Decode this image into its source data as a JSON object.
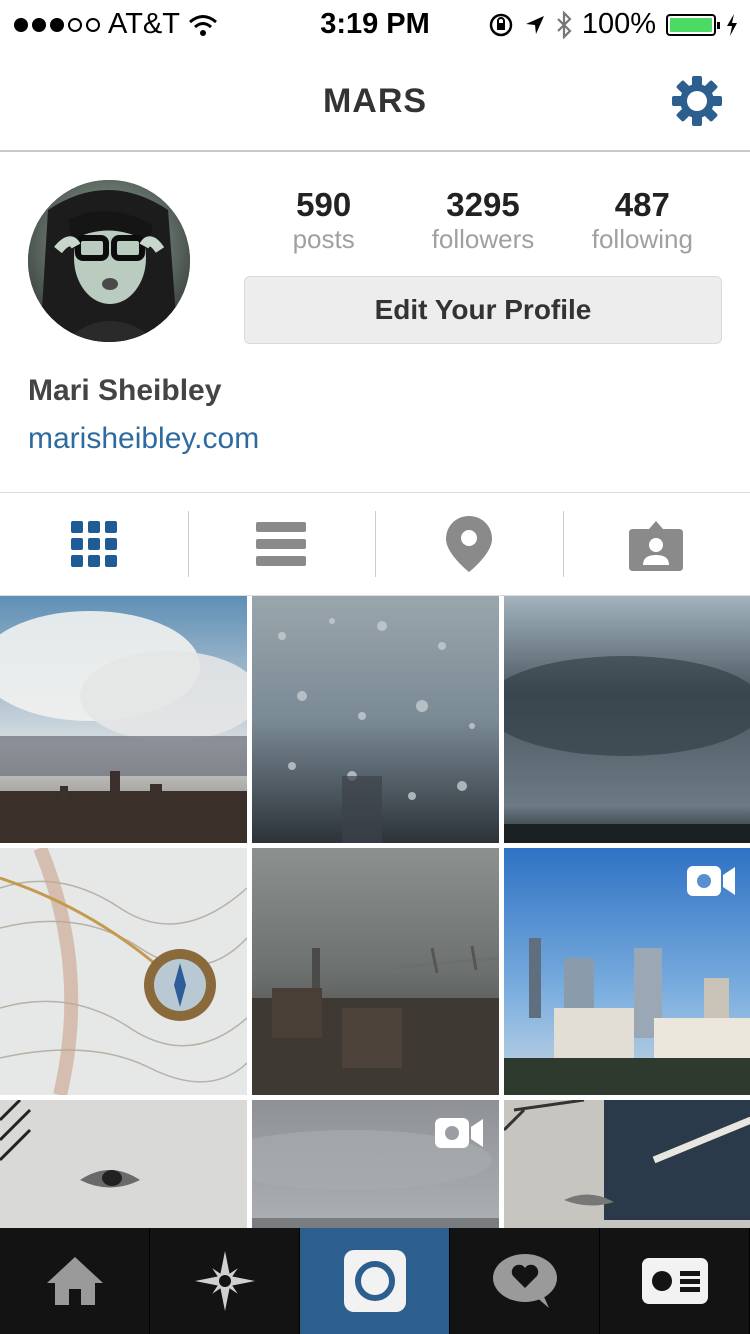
{
  "status_bar": {
    "carrier": "AT&T",
    "time": "3:19 PM",
    "battery": "100%",
    "signal_dots_filled": 3,
    "signal_dots_total": 5
  },
  "nav": {
    "title": "MARS",
    "settings_icon": "gear-icon"
  },
  "profile": {
    "posts_count": "590",
    "posts_label": "posts",
    "followers_count": "3295",
    "followers_label": "followers",
    "following_count": "487",
    "following_label": "following",
    "edit_button": "Edit Your Profile",
    "name": "Mari Sheibley",
    "website": "marisheibley.com"
  },
  "view_tabs": [
    {
      "name": "grid-view",
      "icon": "grid-icon",
      "active": true
    },
    {
      "name": "list-view",
      "icon": "list-icon",
      "active": false
    },
    {
      "name": "map-view",
      "icon": "map-pin-icon",
      "active": false
    },
    {
      "name": "tagged-view",
      "icon": "tagged-person-icon",
      "active": false
    }
  ],
  "photos": [
    {
      "subject": "clouds over city skyline",
      "video": false
    },
    {
      "subject": "raindrops on window",
      "video": false
    },
    {
      "subject": "storm clouds",
      "video": false
    },
    {
      "subject": "compass on topographic map",
      "video": false
    },
    {
      "subject": "hazy city with bridge",
      "video": false
    },
    {
      "subject": "blue sky city buildings",
      "video": true
    },
    {
      "subject": "sketch of eye",
      "video": false
    },
    {
      "subject": "overcast skyline",
      "video": true
    },
    {
      "subject": "sketchbook with pencil",
      "video": false
    }
  ],
  "tab_bar": [
    {
      "icon": "home-icon",
      "active": false
    },
    {
      "icon": "explore-icon",
      "active": false
    },
    {
      "icon": "camera-icon",
      "active": true
    },
    {
      "icon": "activity-icon",
      "active": false
    },
    {
      "icon": "profile-icon",
      "active": false
    }
  ],
  "colors": {
    "accent": "#2d6a9f",
    "tabbar_active": "#2c5f8d",
    "tab_icon_active": "#1f5b95",
    "tab_icon_inactive": "#8a8a8a",
    "battery": "#4cd964"
  }
}
